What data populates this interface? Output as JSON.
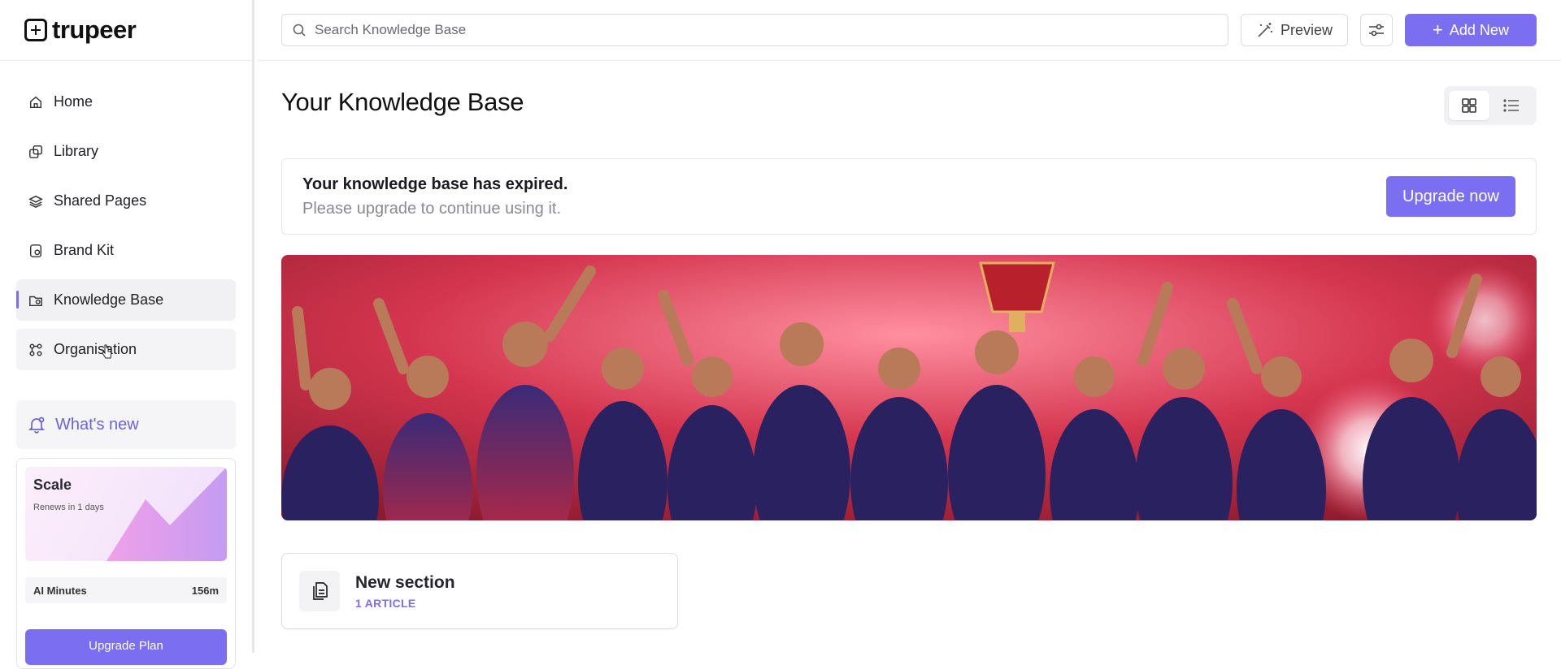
{
  "app": {
    "logo_text": "trupeer"
  },
  "sidebar": {
    "items": [
      {
        "label": "Home",
        "icon": "home-icon"
      },
      {
        "label": "Library",
        "icon": "library-icon"
      },
      {
        "label": "Shared Pages",
        "icon": "layers-icon"
      },
      {
        "label": "Brand Kit",
        "icon": "brand-kit-icon"
      },
      {
        "label": "Knowledge Base",
        "icon": "knowledge-base-icon",
        "active": true
      },
      {
        "label": "Organisation",
        "icon": "organisation-icon"
      }
    ],
    "whats_new": "What's new",
    "plan": {
      "name": "Scale",
      "renews": "Renews in 1 days",
      "ai_minutes_label": "AI Minutes",
      "ai_minutes_value": "156m",
      "upgrade_label": "Upgrade Plan"
    }
  },
  "topbar": {
    "search_placeholder": "Search Knowledge Base",
    "preview_label": "Preview",
    "add_new_label": "Add New"
  },
  "main": {
    "title": "Your Knowledge Base",
    "expired": {
      "title": "Your knowledge base has expired.",
      "subtitle": "Please upgrade to continue using it.",
      "button": "Upgrade now"
    },
    "sections": [
      {
        "title": "New section",
        "count": "1 ARTICLE"
      }
    ]
  },
  "colors": {
    "accent": "#7b6ef0",
    "banner_red": "#c8283c",
    "jersey_navy": "#2a2260"
  }
}
